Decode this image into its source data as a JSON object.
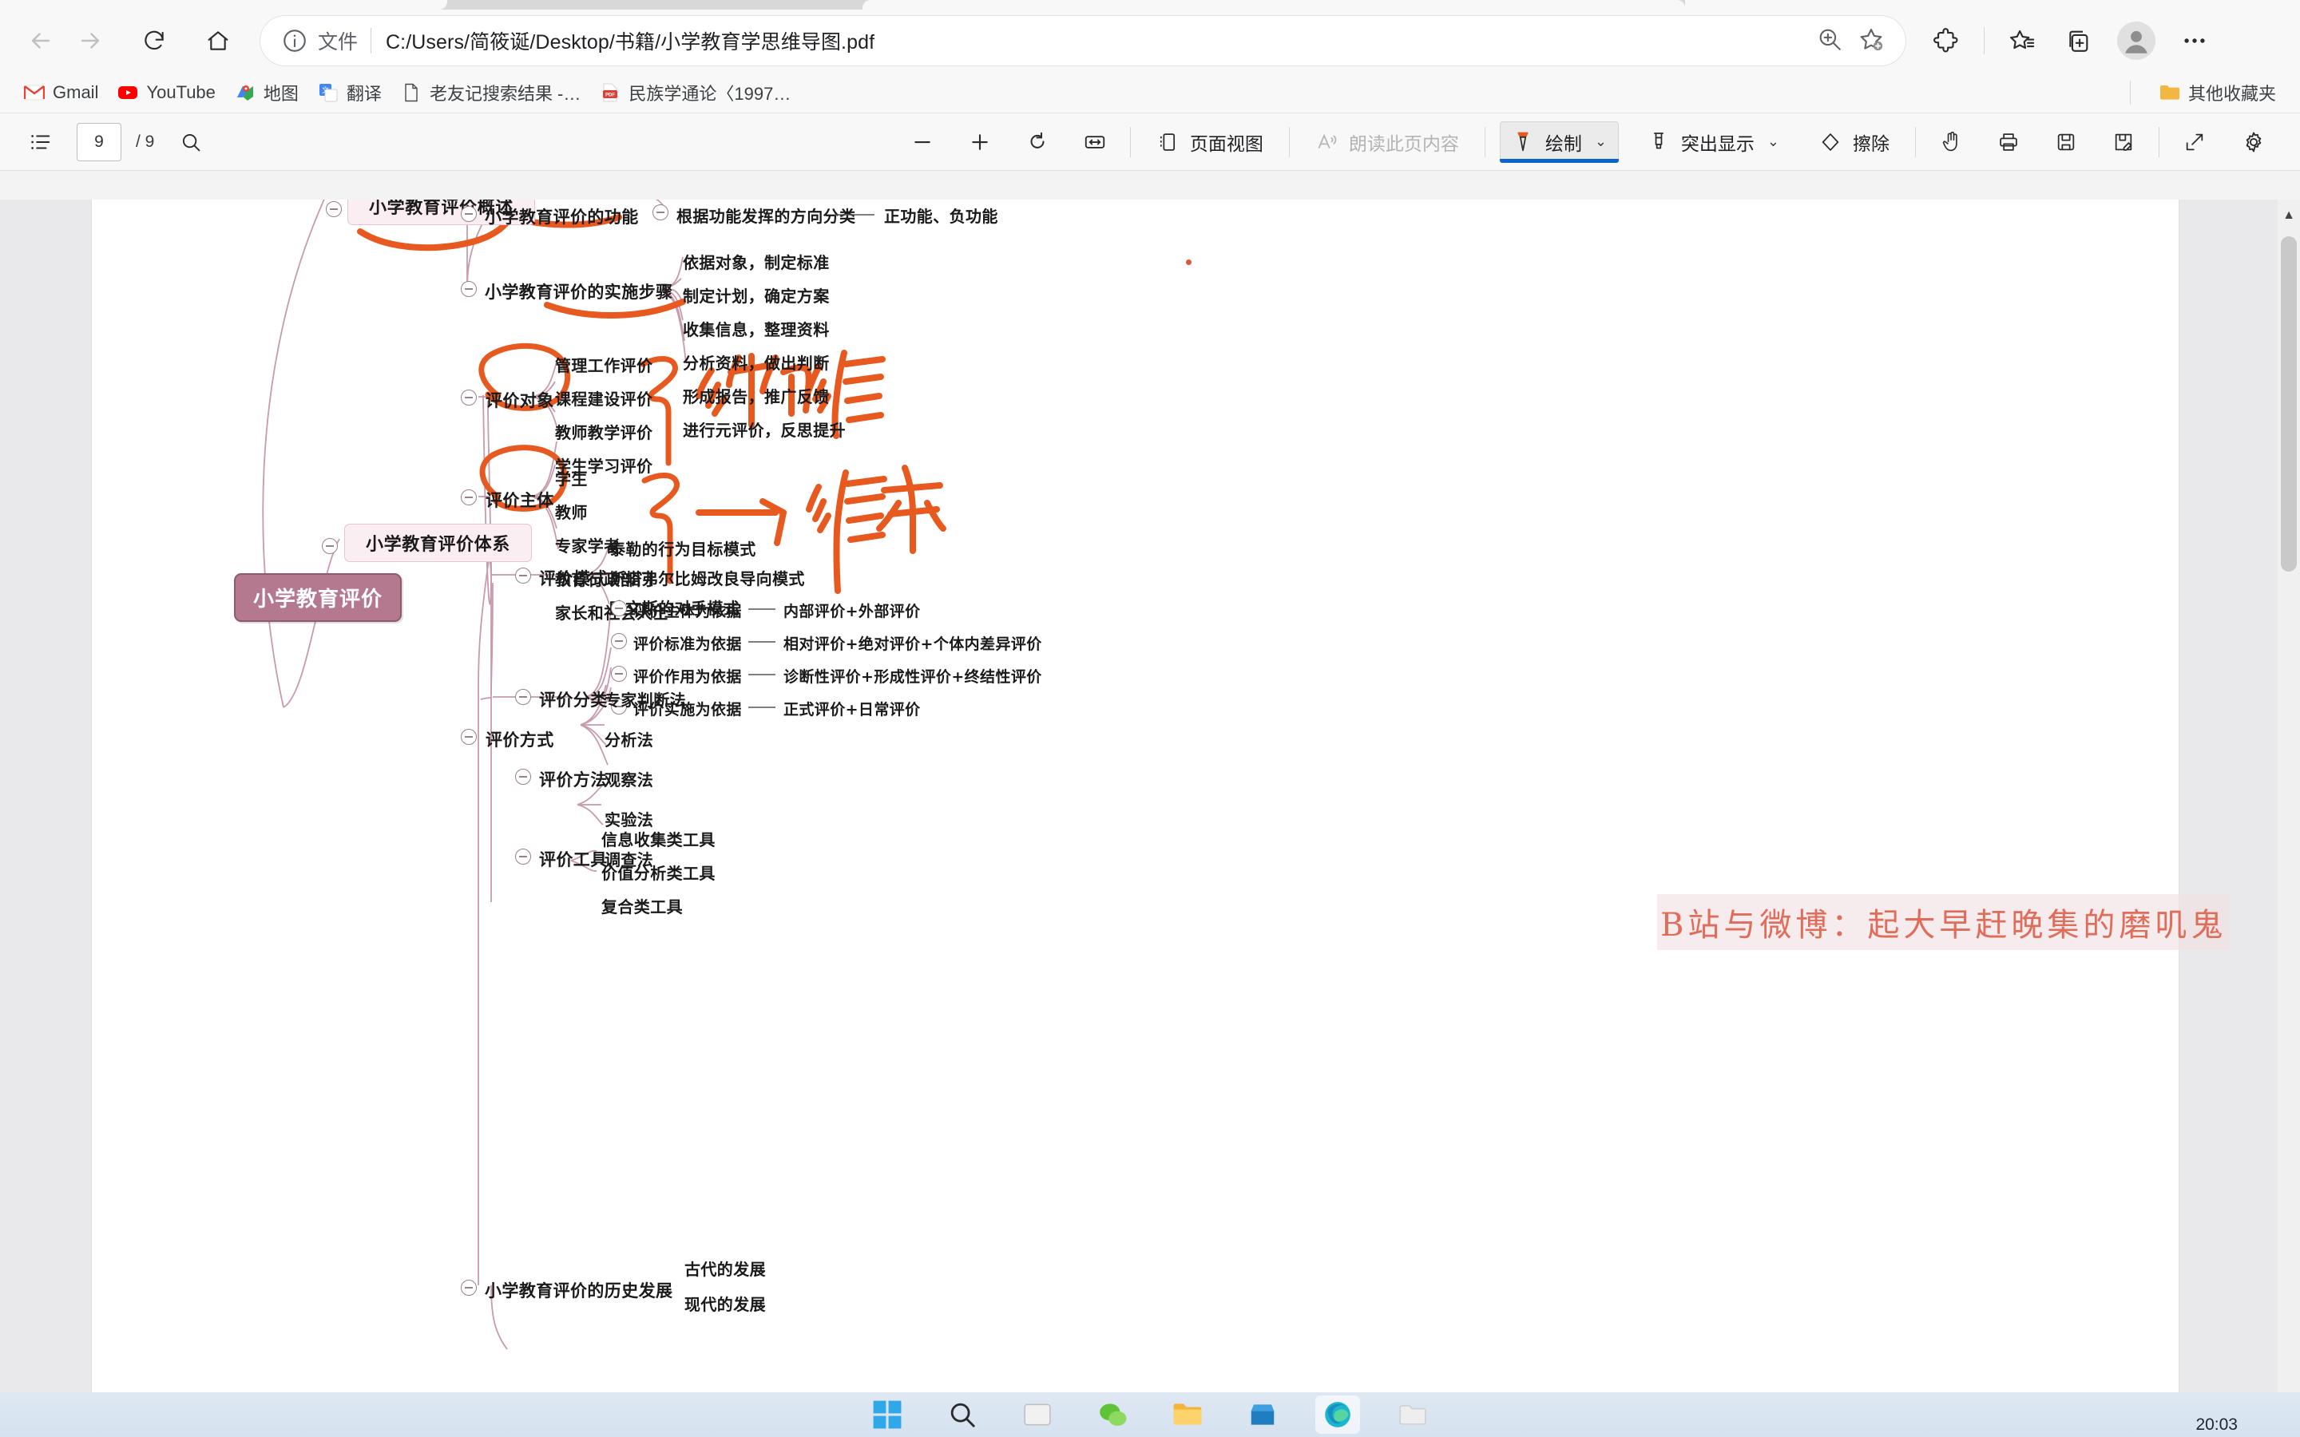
{
  "browser": {
    "nav": {
      "back_label": "Back",
      "forward_label": "Forward",
      "refresh_label": "Refresh",
      "home_label": "Home"
    },
    "omnibox": {
      "scheme_label": "文件",
      "url": "C:/Users/简筱诞/Desktop/书籍/小学教育学思维导图.pdf",
      "zoom_icon": "zoom-in-icon",
      "favorite_icon": "add-favorite-icon"
    },
    "toolbar_right": {
      "extensions_label": "扩展",
      "favorites_label": "收藏夹",
      "collections_label": "集锦",
      "profile_label": "个人资料",
      "settings_label": "设置及其他"
    },
    "bookmarks": [
      {
        "label": "Gmail",
        "icon": "gmail-icon"
      },
      {
        "label": "YouTube",
        "icon": "youtube-icon"
      },
      {
        "label": "地图",
        "icon": "maps-icon"
      },
      {
        "label": "翻译",
        "icon": "translate-icon"
      },
      {
        "label": "老友记搜索结果 -…",
        "icon": "document-icon"
      },
      {
        "label": "民族学通论〈1997…",
        "icon": "pdf-icon"
      }
    ],
    "bookmarks_other": {
      "label": "其他收藏夹",
      "icon": "folder-icon"
    }
  },
  "pdf_toolbar": {
    "thumbnails_label": "页面缩略图",
    "current_page": "9",
    "page_total": "/ 9",
    "search_label": "搜索",
    "zoom_out_label": "缩小",
    "zoom_in_label": "放大",
    "rotate_label": "旋转",
    "fit_label": "适应页面",
    "page_view_label": "页面视图",
    "read_aloud_label": "朗读此页内容",
    "draw_label": "绘制",
    "highlight_label": "突出显示",
    "erase_label": "擦除",
    "hand_label": "手形工具",
    "print_label": "打印",
    "save_label": "保存",
    "save_as_label": "另存为",
    "fullscreen_label": "全屏",
    "settings_label": "设置",
    "caret_glyph": "⌄"
  },
  "mindmap": {
    "root": "小学教育评价",
    "branch_overview": "小学教育评价概述",
    "nodes": {
      "function": "小学教育评价的功能",
      "function_child": "根据功能发挥的方向分类",
      "function_leaf": "正功能、负功能",
      "steps": "小学教育评价的实施步骤",
      "steps_items": [
        "依据对象，制定标准",
        "制定计划，确定方案",
        "收集信息，整理资料",
        "分析资料，做出判断",
        "形成报告，推广反馈",
        "进行元评价，反思提升"
      ],
      "system": "小学教育评价体系",
      "object": "评价对象",
      "object_items": [
        "管理工作评价",
        "课程建设评价",
        "教师教学评价",
        "学生学习评价"
      ],
      "subject": "评价主体",
      "subject_items": [
        "学生",
        "教师",
        "专家学者",
        "教育行政部门",
        "家长和社会人士"
      ],
      "mode": "评价模式",
      "mode_items": [
        "泰勒的行为目标模式",
        "斯塔弗尔比姆改良导向模式",
        "欧文斯的对手模式"
      ],
      "classify": "评价分类",
      "classify_rows": [
        {
          "basis": "评价主体为依据",
          "value": "内部评价+外部评价"
        },
        {
          "basis": "评价标准为依据",
          "value": "相对评价+绝对评价+个体内差异评价"
        },
        {
          "basis": "评价作用为依据",
          "value": "诊断性评价+形成性评价+终结性评价"
        },
        {
          "basis": "评价实施为依据",
          "value": "正式评价+日常评价"
        }
      ],
      "way": "评价方式",
      "method": "评价方法",
      "method_items": [
        "专家判断法",
        "分析法",
        "观察法",
        "实验法",
        "调查法"
      ],
      "tool": "评价工具",
      "tool_items": [
        "信息收集类工具",
        "价值分析类工具",
        "复合类工具"
      ],
      "history": "小学教育评价的历史发展",
      "history_items": [
        "古代的发展",
        "现代的发展"
      ]
    },
    "annotations": [
      {
        "text": "→评价谁",
        "kind": "handwriting"
      },
      {
        "text": "→谁来评价",
        "kind": "handwriting"
      }
    ],
    "watermark": "B站与微博：起大早赶晚集的磨叽鬼",
    "colors": {
      "root_fill": "#b4788f",
      "box_fill": "#fbeef2",
      "branch_line": "#c79aae",
      "ink": "#e8591f",
      "watermark": "#e06c5a"
    }
  },
  "taskbar": {
    "items": [
      {
        "name": "start-icon"
      },
      {
        "name": "search-icon"
      },
      {
        "name": "task-view-icon"
      },
      {
        "name": "wechat-icon"
      },
      {
        "name": "file-explorer-icon"
      },
      {
        "name": "store-icon"
      },
      {
        "name": "edge-icon"
      },
      {
        "name": "folder-icon"
      }
    ],
    "clock_time": "20:03"
  }
}
